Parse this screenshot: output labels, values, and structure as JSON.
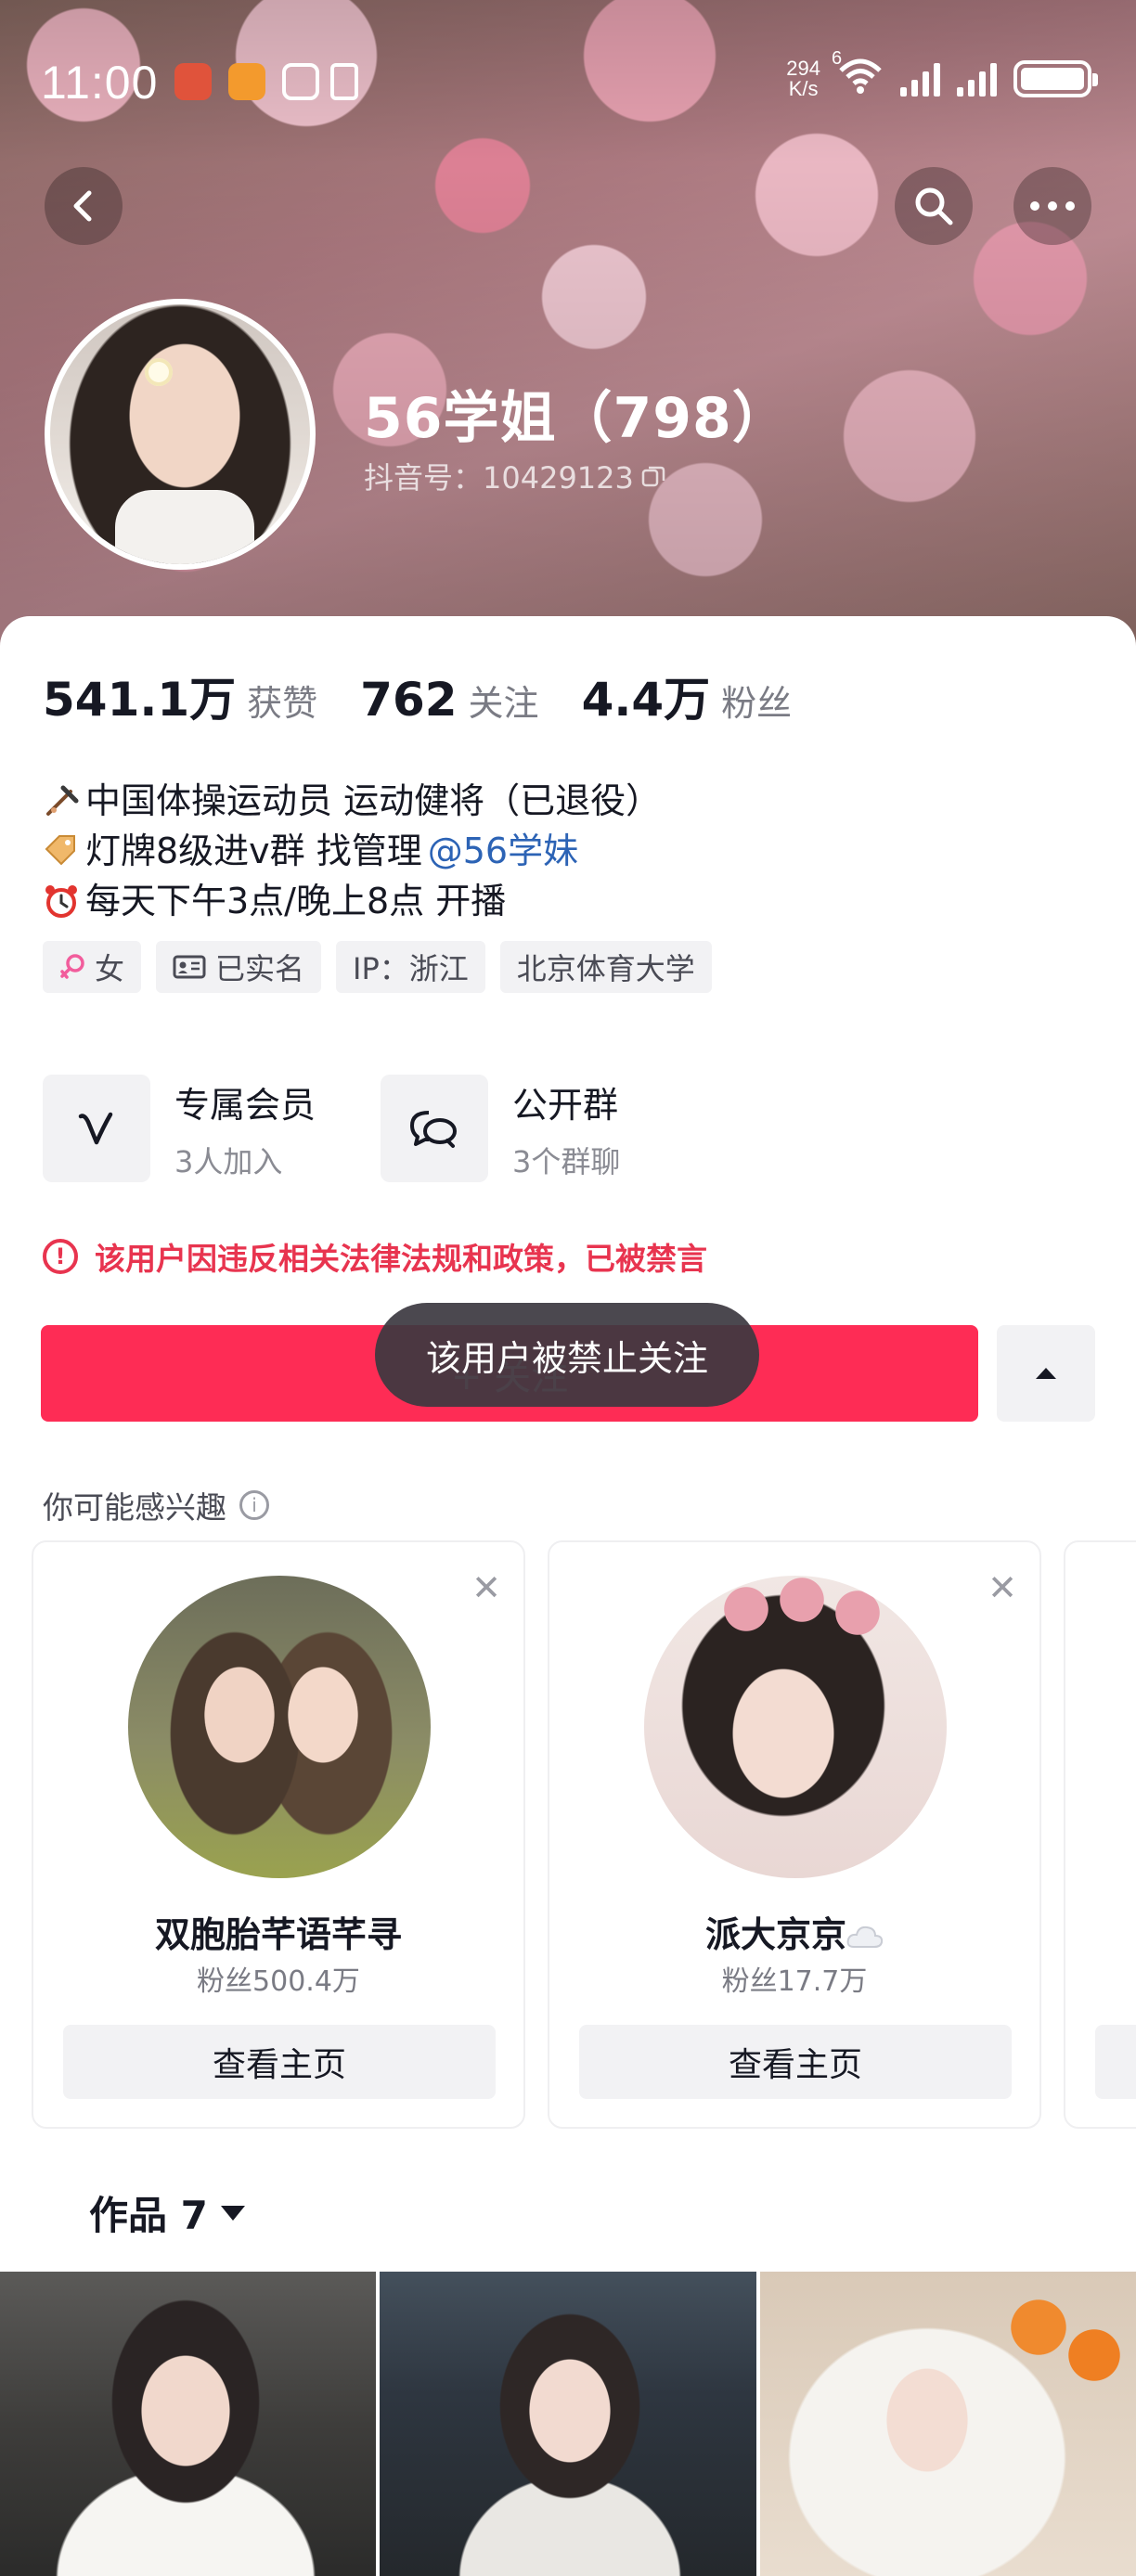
{
  "status_bar": {
    "time": "11:00",
    "net_speed_value": "294",
    "net_speed_unit": "K/s",
    "wifi_badge": "6"
  },
  "profile": {
    "nickname": "56学姐（798）",
    "douyin_id": "抖音号：10429123"
  },
  "stats": [
    {
      "value": "541.1万",
      "label": "获赞"
    },
    {
      "value": "762",
      "label": "关注"
    },
    {
      "value": "4.4万",
      "label": "粉丝"
    }
  ],
  "bio": {
    "line1": "中国体操运动员 运动健将（已退役）",
    "line2_prefix": "灯牌8级进v群 找管理",
    "line2_mention": "@56学妹",
    "line3": "每天下午3点/晚上8点 开播"
  },
  "tags": [
    "女",
    "已实名",
    "IP：浙江",
    "北京体育大学"
  ],
  "features": [
    {
      "title": "专属会员",
      "subtitle": "3人加入"
    },
    {
      "title": "公开群",
      "subtitle": "3个群聊"
    }
  ],
  "ban_notice": "该用户因违反相关法律法规和政策，已被禁言",
  "follow_button": "+ 关注",
  "toast": "该用户被禁止关注",
  "suggestions": {
    "title": "你可能感兴趣",
    "cards": [
      {
        "name": "双胞胎芊语芊寻",
        "fans": "粉丝500.4万",
        "button": "查看主页"
      },
      {
        "name": "派大京京",
        "fans": "粉丝17.7万",
        "button": "查看主页"
      }
    ]
  },
  "works_tab": {
    "label": "作品 7"
  },
  "colors": {
    "accent_red": "#fe2c55",
    "warning_red": "#e8344f",
    "mention_blue": "#2c63b5"
  }
}
